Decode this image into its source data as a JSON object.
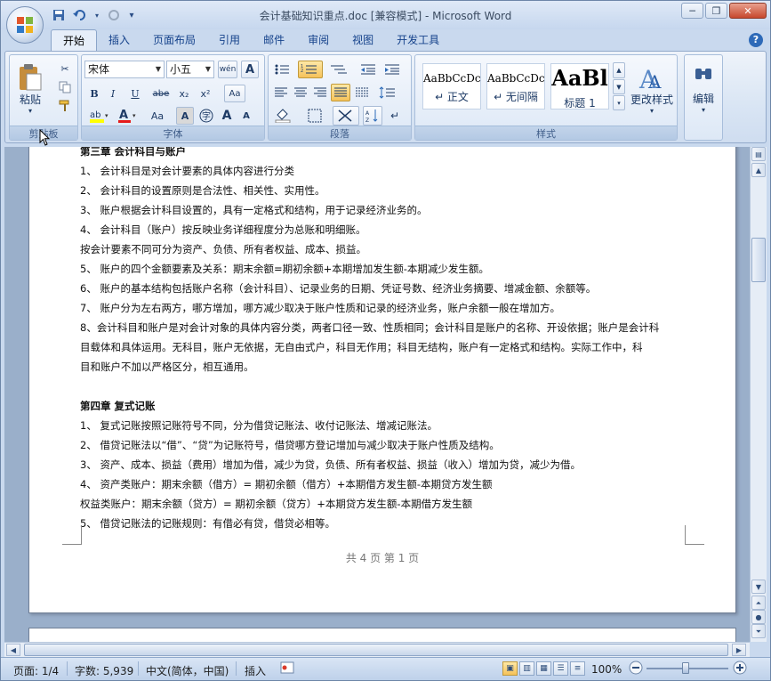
{
  "window": {
    "title": "会计基础知识重点.doc [兼容模式] - Microsoft Word",
    "minimize": "─",
    "restore": "❐",
    "close": "✕"
  },
  "qat": {
    "save_icon": "save-icon",
    "undo_icon": "undo-icon",
    "redo_icon": "redo-icon"
  },
  "tabs": [
    "开始",
    "插入",
    "页面布局",
    "引用",
    "邮件",
    "审阅",
    "视图",
    "开发工具"
  ],
  "ribbon": {
    "clipboard": {
      "paste": "粘贴",
      "label": "剪贴板"
    },
    "font": {
      "name": "宋体",
      "size": "小五",
      "label": "字体",
      "wen": "wén\n变",
      "bold": "B",
      "italic": "I",
      "underline": "U",
      "strike": "abe",
      "sub": "x₂",
      "sup": "x²",
      "grow": "A",
      "shrink": "A",
      "case": "Aa",
      "clear": "A",
      "phonetic": "字"
    },
    "paragraph": {
      "label": "段落"
    },
    "styles": {
      "label": "样式",
      "items": [
        {
          "sample": "AaBbCcDc",
          "name": "↵ 正文"
        },
        {
          "sample": "AaBbCcDc",
          "name": "↵ 无间隔"
        },
        {
          "sample": "AaBl",
          "name": "标题 1"
        }
      ],
      "change": "更改样式"
    },
    "editing": {
      "label": "编辑"
    }
  },
  "document": {
    "lines": [
      {
        "t": "第三章 会计科目与账户",
        "h": true
      },
      {
        "t": "1、  会计科目是对会计要素的具体内容进行分类"
      },
      {
        "t": "2、  会计科目的设置原则是合法性、相关性、实用性。"
      },
      {
        "t": "3、  账户根据会计科目设置的，具有一定格式和结构，用于记录经济业务的。"
      },
      {
        "t": "4、  会计科目（账户）按反映业务详细程度分为总账和明细账。"
      },
      {
        "t": "      按会计要素不同可分为资产、负债、所有者权益、成本、损益。"
      },
      {
        "t": "5、  账户的四个金额要素及关系：期末余额=期初余额+本期增加发生额-本期减少发生额。"
      },
      {
        "t": "6、  账户的基本结构包括账户名称（会计科目）、记录业务的日期、凭证号数、经济业务摘要、增减金额、余额等。"
      },
      {
        "t": "7、  账户分为左右两方，哪方增加，哪方减少取决于账户性质和记录的经济业务，账户余额一般在增加方。"
      },
      {
        "t": "8、会计科目和账户是对会计对象的具体内容分类，两者口径一致、性质相同；会计科目是账户的名称、开设依据；账户是会计科"
      },
      {
        "t": "      目载体和具体运用。无科目，账户无依据，无自由式户，科目无作用；科目无结构，账户有一定格式和结构。实际工作中，科"
      },
      {
        "t": "      目和账户不加以严格区分，相互通用。"
      },
      {
        "t": ""
      },
      {
        "t": "第四章 复式记账",
        "h": true
      },
      {
        "t": "1、  复式记账按照记账符号不同，分为借贷记账法、收付记账法、增减记账法。"
      },
      {
        "t": "2、  借贷记账法以“借”、“贷”为记账符号，借贷哪方登记增加与减少取决于账户性质及结构。"
      },
      {
        "t": "3、  资产、成本、损益（费用）增加为借，减少为贷，负债、所有者权益、损益（收入）增加为贷，减少为借。"
      },
      {
        "t": "4、  资产类账户：期末余额（借方）= 期初余额（借方）+本期借方发生额-本期贷方发生额"
      },
      {
        "t": "      权益类账户：期末余额（贷方）= 期初余额（贷方）+本期贷方发生额-本期借方发生额"
      },
      {
        "t": "5、  借贷记账法的记账规则：有借必有贷，借贷必相等。"
      }
    ],
    "footer": "共 4 页    第 1 页"
  },
  "status": {
    "page": "页面: 1/4",
    "words": "字数: 5,939",
    "lang": "中文(简体，中国)",
    "insert": "插入",
    "zoom": "100%"
  }
}
